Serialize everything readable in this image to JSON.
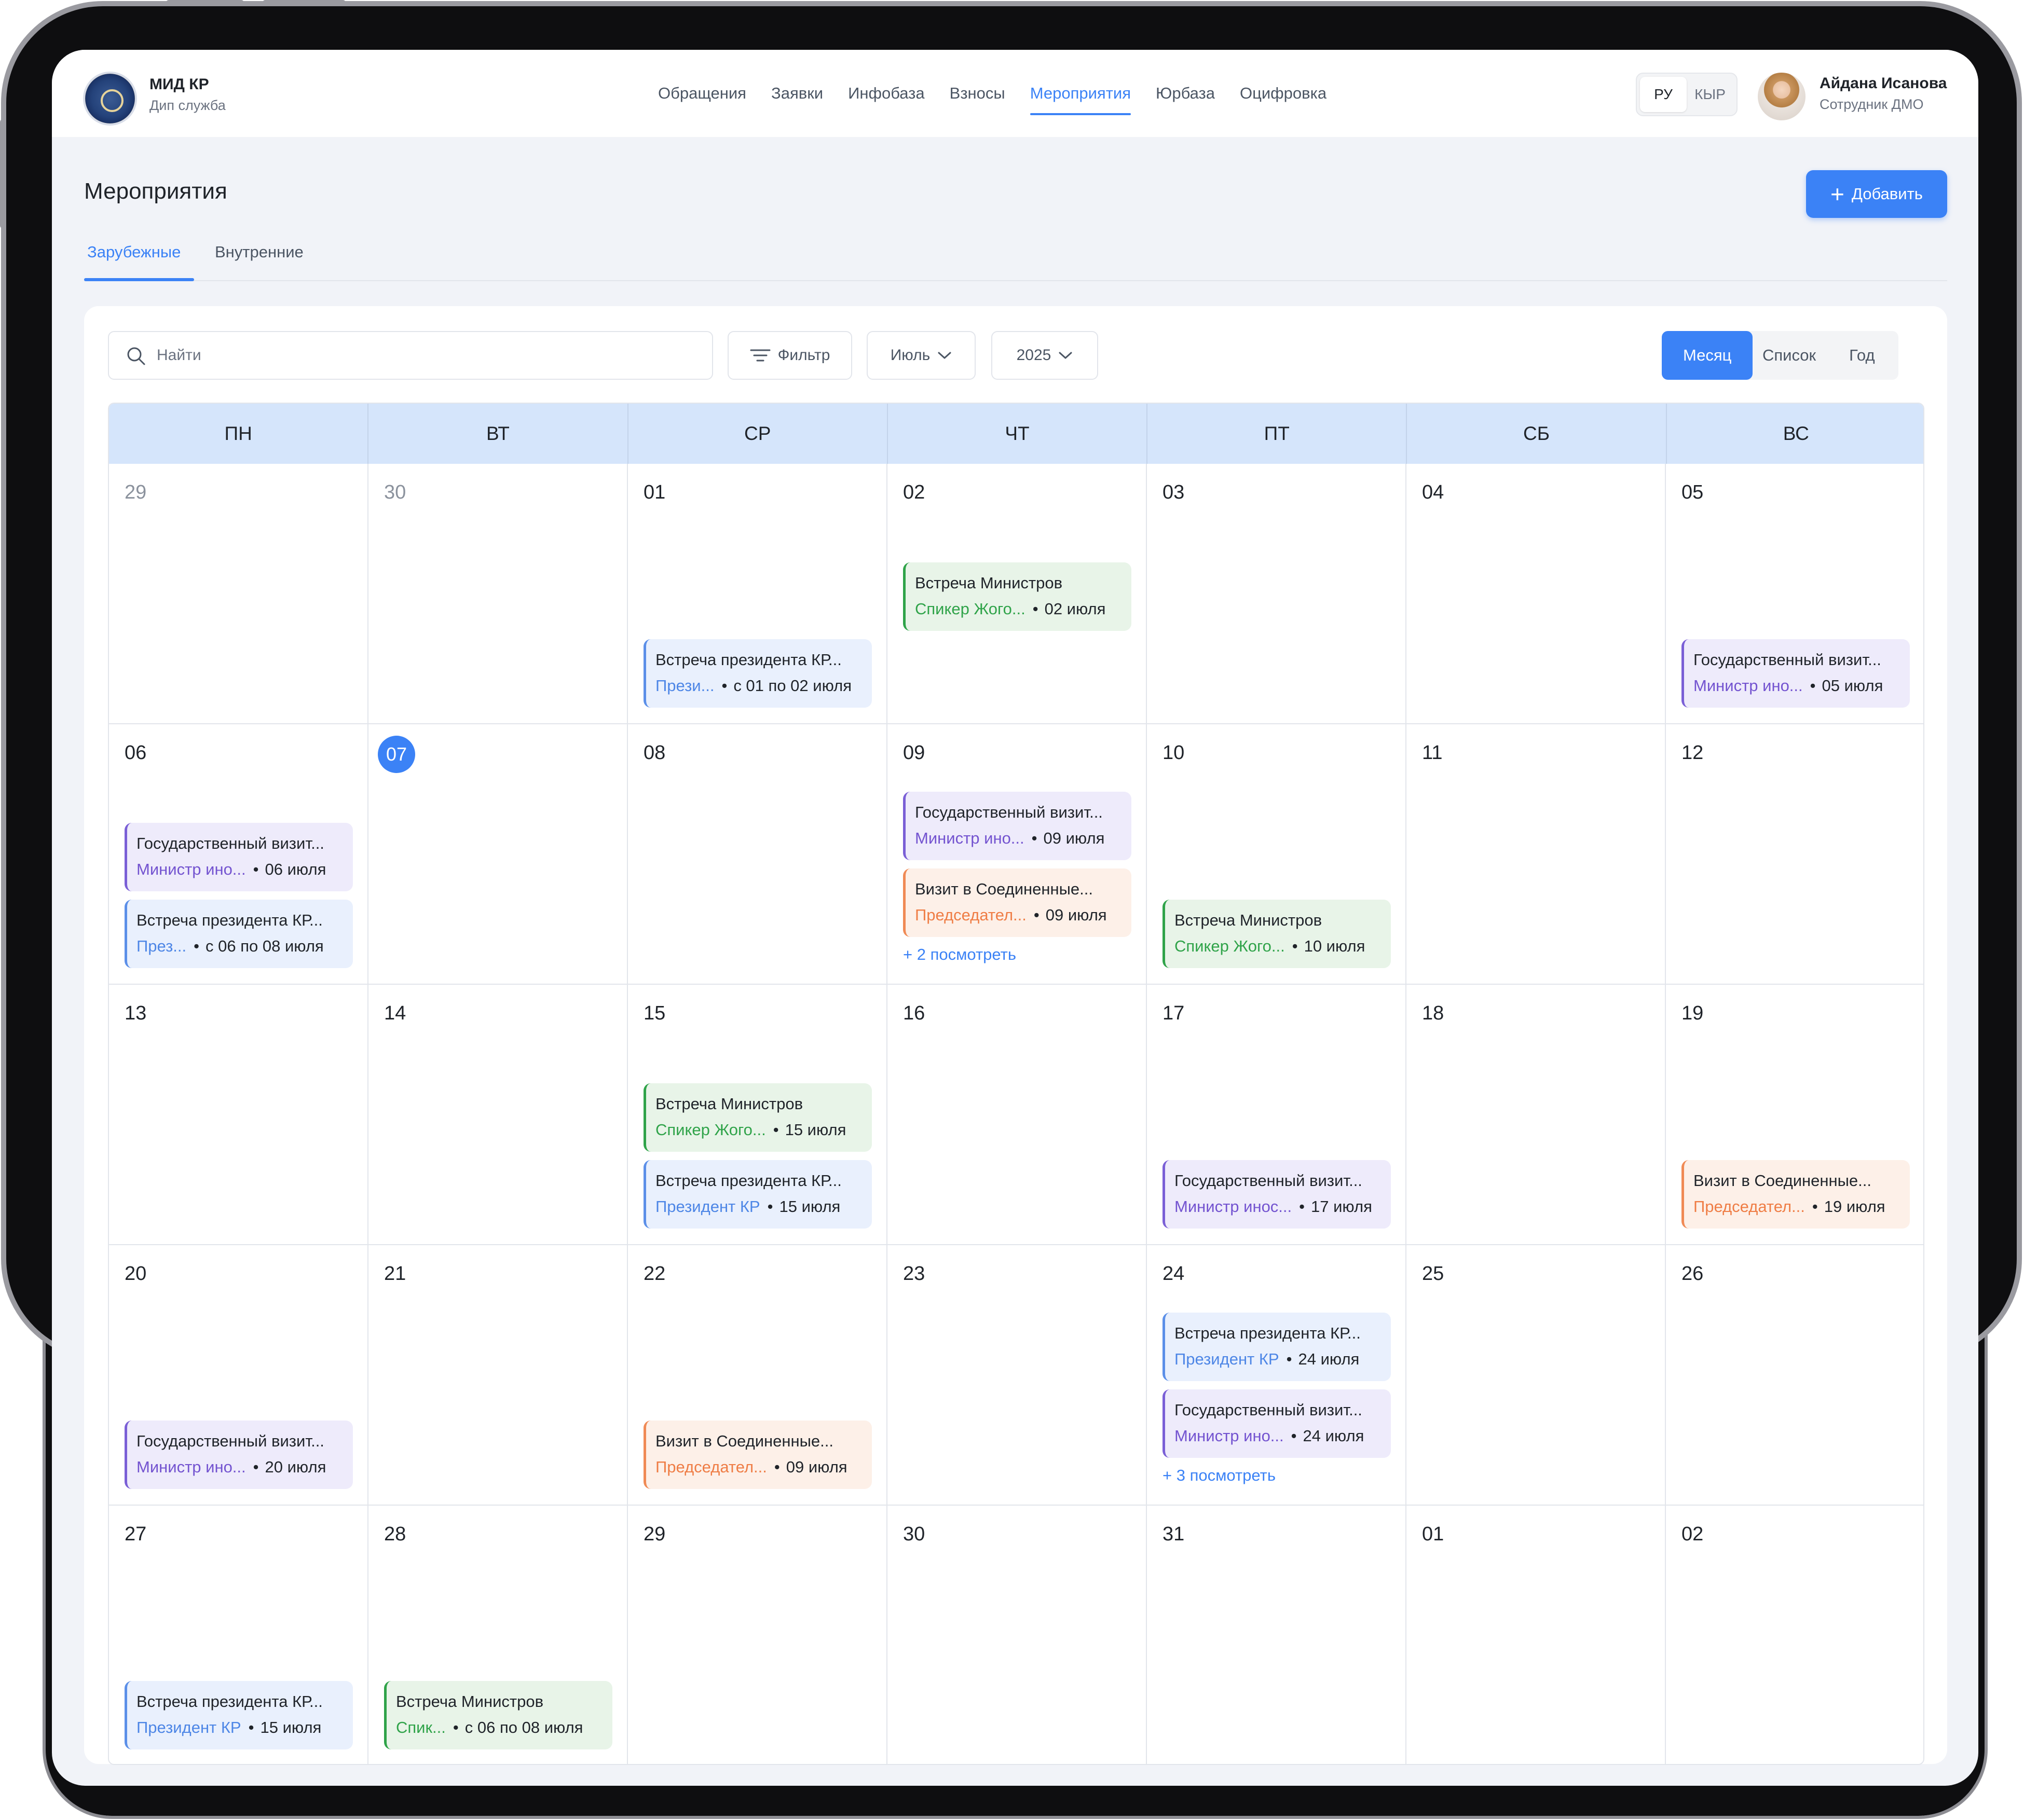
{
  "org": {
    "name": "МИД КР",
    "subtitle": "Дип служба"
  },
  "nav": [
    "Обращения",
    "Заявки",
    "Инфобаза",
    "Взносы",
    "Мероприятия",
    "Юрбаза",
    "Оцифровка"
  ],
  "nav_active": "Мероприятия",
  "lang": {
    "ru": "РУ",
    "ky": "КЫР",
    "active": "РУ"
  },
  "user": {
    "name": "Айдана Исанова",
    "role": "Сотрудник ДМО"
  },
  "page": {
    "title": "Мероприятия",
    "add_label": "Добавить"
  },
  "tabs": [
    "Зарубежные",
    "Внутренние"
  ],
  "tab_active": "Зарубежные",
  "toolbar": {
    "search_placeholder": "Найти",
    "filter_label": "Фильтр",
    "month": "Июль",
    "year": "2025",
    "views": [
      "Месяц",
      "Список",
      "Год"
    ],
    "view_active": "Месяц"
  },
  "colors": {
    "accent": "#3b82f6",
    "header_bg": "#d5e5fb",
    "green": "#2fa349",
    "blue": "#4d86e6",
    "purple": "#7353d0",
    "orange": "#ef7d45"
  },
  "weekdays": [
    "ПН",
    "ВТ",
    "СР",
    "ЧТ",
    "ПТ",
    "СБ",
    "ВС"
  ],
  "weeks": [
    [
      {
        "day": "29",
        "muted": true,
        "events": []
      },
      {
        "day": "30",
        "muted": true,
        "events": []
      },
      {
        "day": "01",
        "events": [
          {
            "title": "Встреча президента КР...",
            "who": "Прези...",
            "date": "с 01 по 02 июля",
            "color": "blue"
          }
        ]
      },
      {
        "day": "02",
        "events": [
          {
            "title": "Встреча Министров",
            "who": "Спикер Жого...",
            "date": "02 июля",
            "color": "green"
          }
        ]
      },
      {
        "day": "03",
        "events": []
      },
      {
        "day": "04",
        "events": []
      },
      {
        "day": "05",
        "events": [
          {
            "title": "Государственный визит...",
            "who": "Министр ино...",
            "date": "05 июля",
            "color": "purple"
          }
        ]
      }
    ],
    [
      {
        "day": "06",
        "events": [
          {
            "title": "Государственный визит...",
            "who": "Министр ино...",
            "date": "06 июля",
            "color": "purple"
          },
          {
            "title": "Встреча президента КР...",
            "who": "През...",
            "date": "с 06 по 08 июля",
            "color": "blue"
          }
        ]
      },
      {
        "day": "07",
        "today": true,
        "events": []
      },
      {
        "day": "08",
        "events": []
      },
      {
        "day": "09",
        "events": [
          {
            "title": "Государственный визит...",
            "who": "Министр ино...",
            "date": "09 июля",
            "color": "purple"
          },
          {
            "title": "Визит в Соединенные...",
            "who": "Председател...",
            "date": "09 июля",
            "color": "orange"
          }
        ],
        "more": "+ 2 посмотреть"
      },
      {
        "day": "10",
        "events": [
          {
            "title": "Встреча Министров",
            "who": "Спикер Жого...",
            "date": "10 июля",
            "color": "green"
          }
        ]
      },
      {
        "day": "11",
        "events": []
      },
      {
        "day": "12",
        "events": []
      }
    ],
    [
      {
        "day": "13",
        "events": []
      },
      {
        "day": "14",
        "events": []
      },
      {
        "day": "15",
        "events": [
          {
            "title": "Встреча Министров",
            "who": "Спикер Жого...",
            "date": "15 июля",
            "color": "green"
          },
          {
            "title": "Встреча президента КР...",
            "who": "Президент КР",
            "date": "15 июля",
            "color": "blue"
          }
        ]
      },
      {
        "day": "16",
        "events": []
      },
      {
        "day": "17",
        "events": [
          {
            "title": "Государственный визит...",
            "who": "Министр инос...",
            "date": "17 июля",
            "color": "purple"
          }
        ]
      },
      {
        "day": "18",
        "events": []
      },
      {
        "day": "19",
        "events": [
          {
            "title": "Визит в Соединенные...",
            "who": "Председател...",
            "date": "19 июля",
            "color": "orange"
          }
        ]
      }
    ],
    [
      {
        "day": "20",
        "events": [
          {
            "title": "Государственный визит...",
            "who": "Министр ино...",
            "date": "20 июля",
            "color": "purple"
          }
        ]
      },
      {
        "day": "21",
        "events": []
      },
      {
        "day": "22",
        "events": [
          {
            "title": "Визит в Соединенные...",
            "who": "Председател...",
            "date": "09 июля",
            "color": "orange"
          }
        ]
      },
      {
        "day": "23",
        "events": []
      },
      {
        "day": "24",
        "events": [
          {
            "title": "Встреча президента КР...",
            "who": "Президент КР",
            "date": "24 июля",
            "color": "blue"
          },
          {
            "title": "Государственный визит...",
            "who": "Министр ино...",
            "date": "24 июля",
            "color": "purple"
          }
        ],
        "more": "+ 3 посмотреть"
      },
      {
        "day": "25",
        "events": []
      },
      {
        "day": "26",
        "events": []
      }
    ],
    [
      {
        "day": "27",
        "events": [
          {
            "title": "Встреча президента КР...",
            "who": "Президент КР",
            "date": "15 июля",
            "color": "blue"
          }
        ]
      },
      {
        "day": "28",
        "events": [
          {
            "title": "Встреча Министров",
            "who": "Спик...",
            "date": "с 06 по 08 июля",
            "color": "green"
          }
        ]
      },
      {
        "day": "29",
        "events": []
      },
      {
        "day": "30",
        "events": []
      },
      {
        "day": "31",
        "events": []
      },
      {
        "day": "01",
        "events": []
      },
      {
        "day": "02",
        "events": []
      }
    ]
  ]
}
